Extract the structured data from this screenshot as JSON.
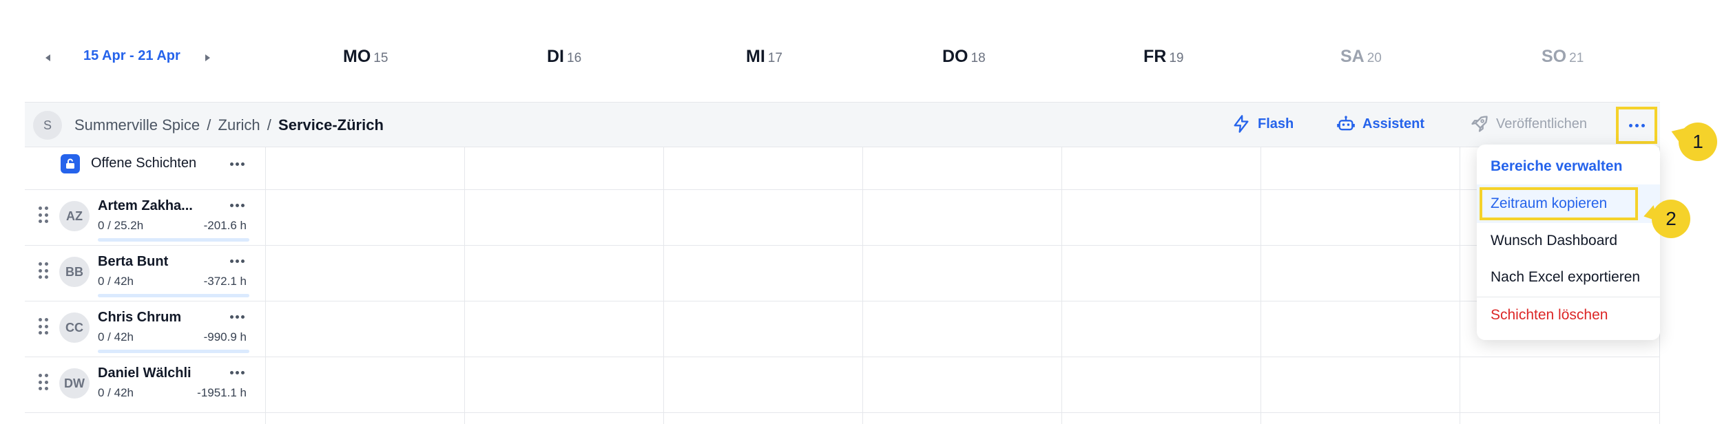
{
  "week": {
    "range_label": "15 Apr - 21 Apr",
    "days": [
      {
        "name": "MO",
        "num": "15"
      },
      {
        "name": "DI",
        "num": "16"
      },
      {
        "name": "MI",
        "num": "17"
      },
      {
        "name": "DO",
        "num": "18"
      },
      {
        "name": "FR",
        "num": "19"
      },
      {
        "name": "SA",
        "num": "20"
      },
      {
        "name": "SO",
        "num": "21"
      }
    ]
  },
  "toolbar": {
    "area_avatar": "S",
    "breadcrumb": {
      "company": "Summerville Spice",
      "location": "Zurich",
      "area": "Service-Zürich",
      "separator": "/"
    },
    "flash_label": "Flash",
    "assistant_label": "Assistent",
    "publish_label": "Veröffentlichen"
  },
  "open_shifts": {
    "label": "Offene Schichten"
  },
  "employees": [
    {
      "initials": "AZ",
      "name": "Artem Zakha...",
      "hours": "0 / 25.2h",
      "balance": "-201.6 h"
    },
    {
      "initials": "BB",
      "name": "Berta Bunt",
      "hours": "0 / 42h",
      "balance": "-372.1 h"
    },
    {
      "initials": "CC",
      "name": "Chris Chrum",
      "hours": "0 / 42h",
      "balance": "-990.9 h"
    },
    {
      "initials": "DW",
      "name": "Daniel Wälchli",
      "hours": "0 / 42h",
      "balance": "-1951.1 h"
    }
  ],
  "menu": {
    "manage_areas": "Bereiche verwalten",
    "copy_period": "Zeitraum kopieren",
    "wish_dashboard": "Wunsch Dashboard",
    "export_excel": "Nach Excel exportieren",
    "delete_shifts": "Schichten löschen"
  },
  "callouts": [
    "1",
    "2"
  ],
  "colors": {
    "accent": "#2563eb",
    "highlight": "#f5d22a",
    "danger": "#dc2626"
  }
}
